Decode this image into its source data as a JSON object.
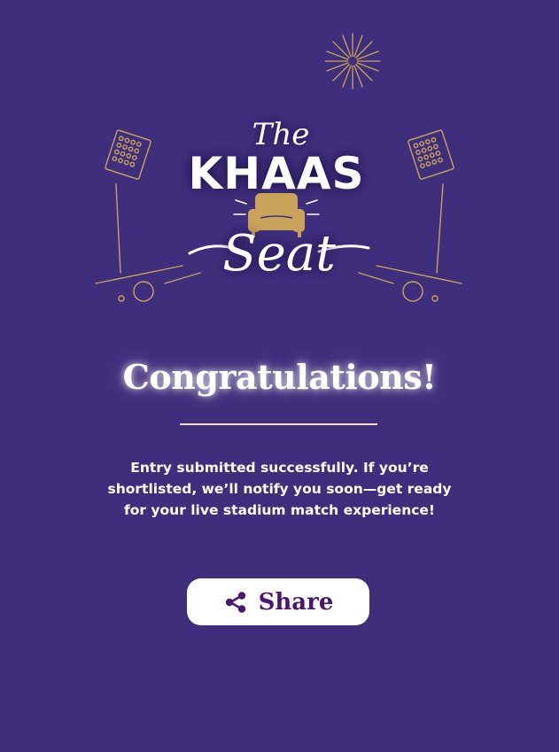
{
  "logo": {
    "line1": "The",
    "line2": "KHAAS",
    "line3": "Seat"
  },
  "title": "Congratulations!",
  "message": "Entry submitted successfully. If you’re shortlisted, we’ll notify you soon—get ready for your live stadium match experience!",
  "share_button": {
    "label": "Share",
    "icon": "share-icon"
  },
  "colors": {
    "background": "#3f2e7c",
    "gold_accent": "#c9a35a",
    "button_text": "#4a1670",
    "button_background": "#ffffff"
  }
}
